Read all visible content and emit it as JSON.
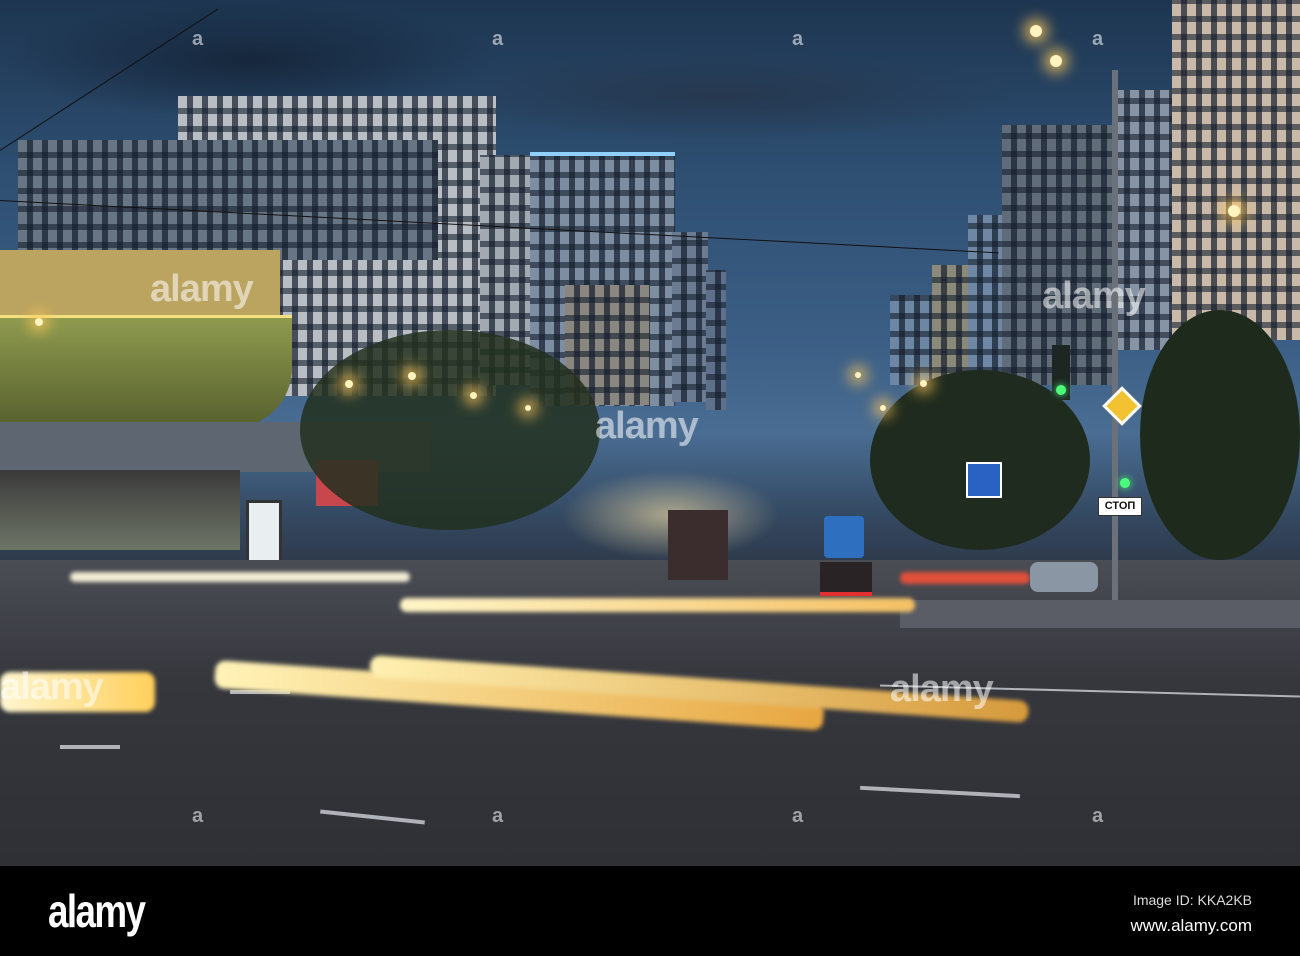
{
  "photo": {
    "road_sign_text": "СТОП",
    "watermark_text": "alamy",
    "watermark_glyph": "a"
  },
  "footer": {
    "logo": "alamy",
    "image_id": "Image ID: KKA2KB",
    "url": "www.alamy.com"
  }
}
